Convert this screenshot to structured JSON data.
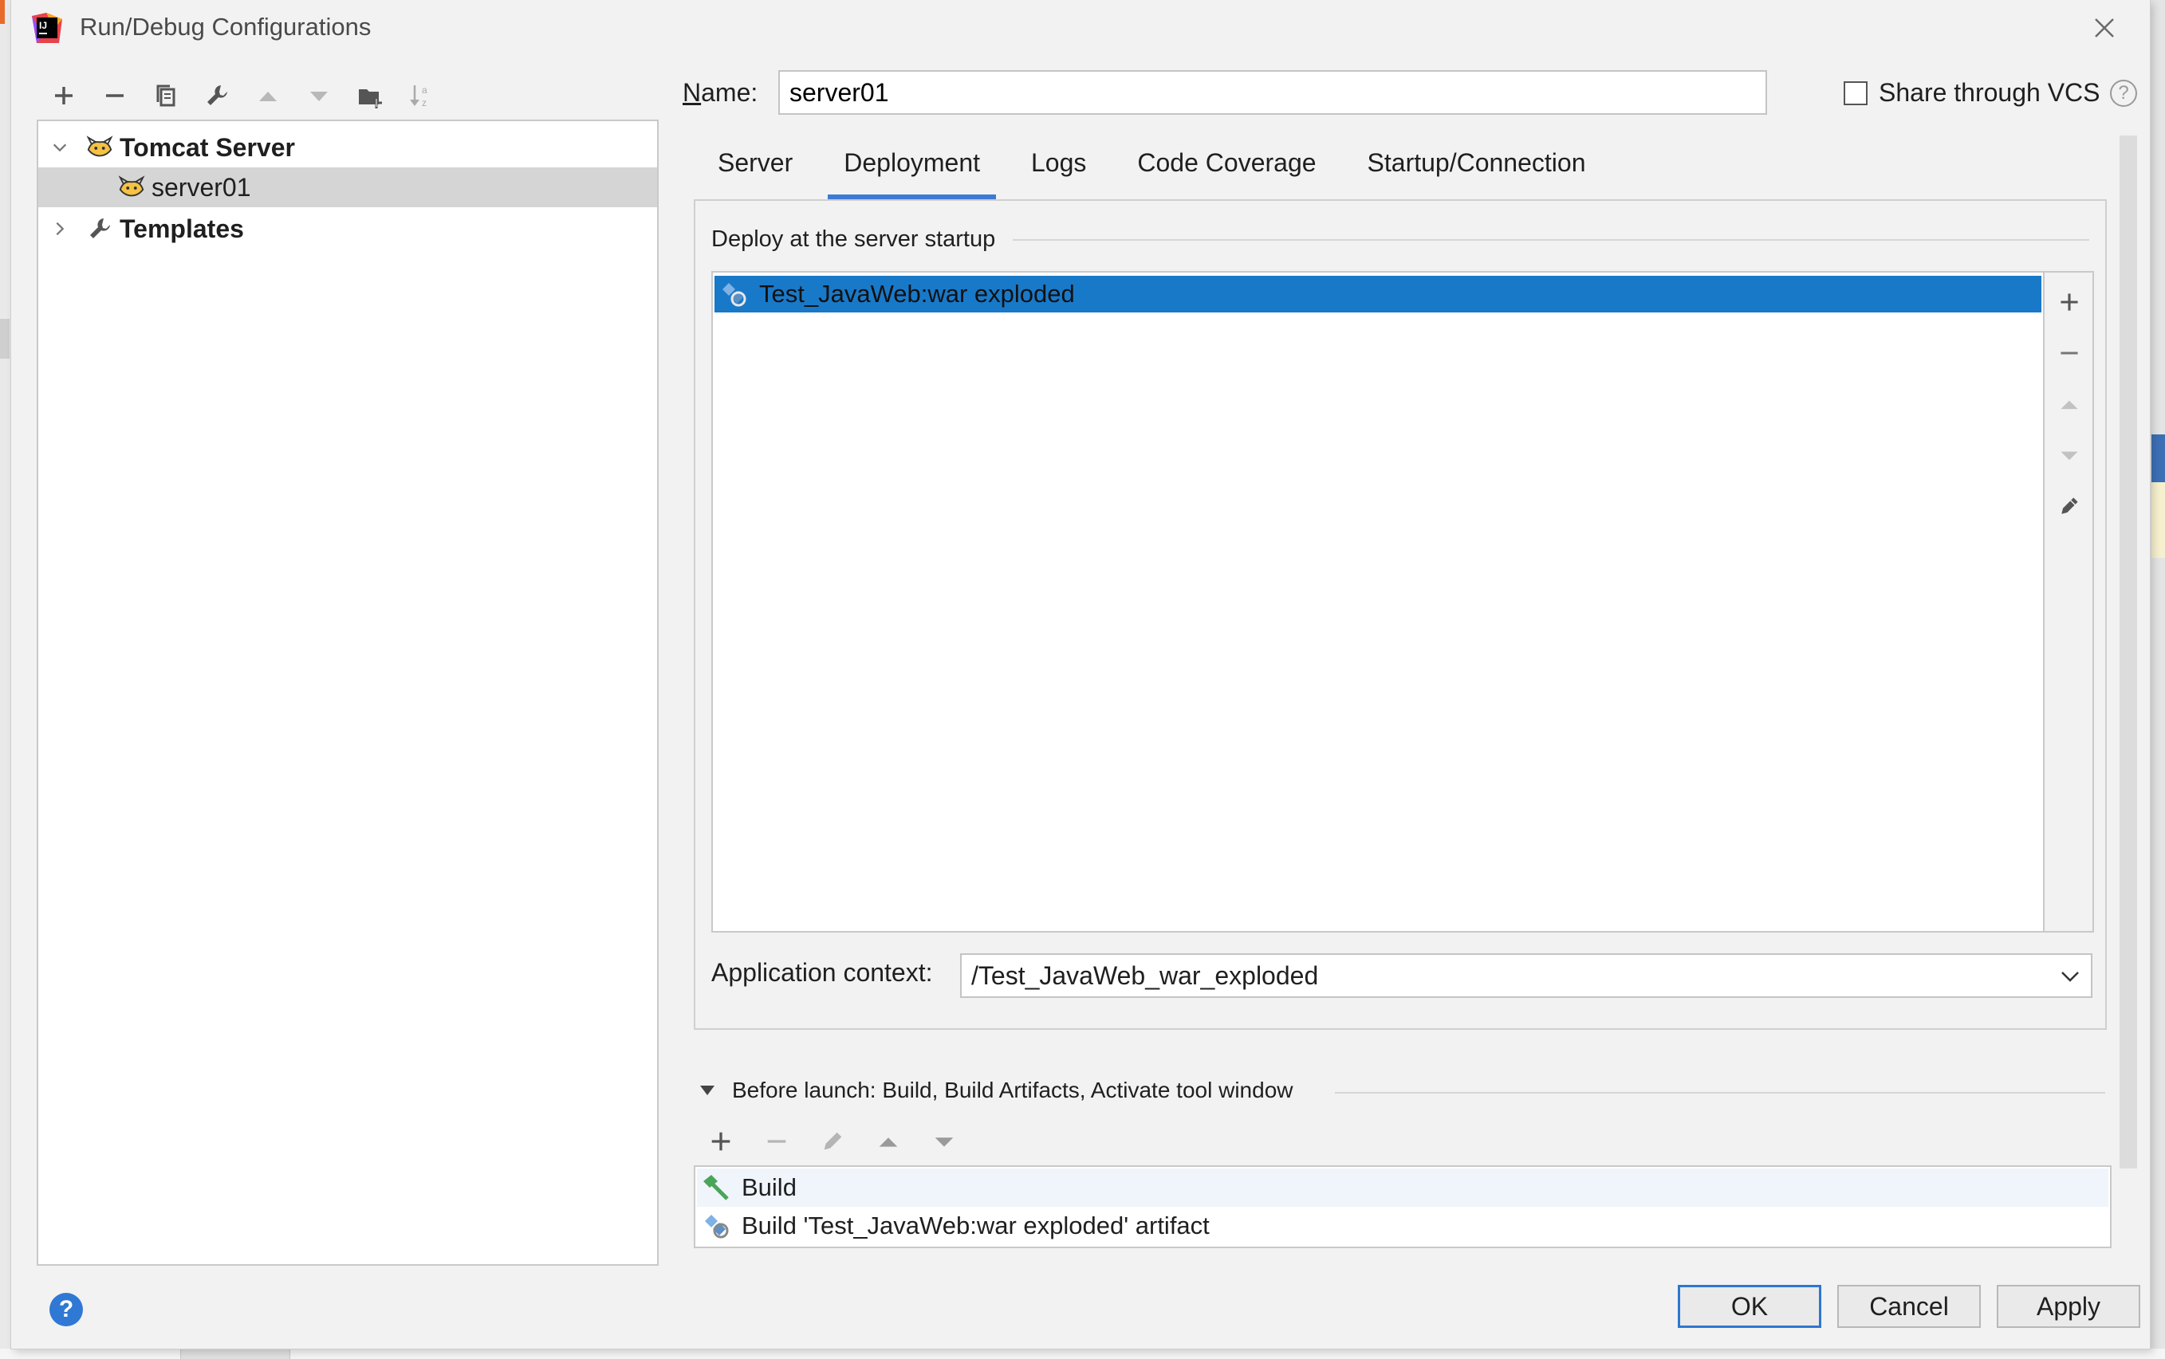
{
  "window": {
    "title": "Run/Debug Configurations"
  },
  "left_toolbar": {
    "icons": [
      "add-icon",
      "remove-icon",
      "copy-icon",
      "wrench-icon",
      "move-up-icon",
      "move-down-icon",
      "new-folder-icon",
      "sort-icon"
    ]
  },
  "tree": {
    "items": [
      {
        "label": "Tomcat Server",
        "expanded": true,
        "icon": "tomcat-icon"
      },
      {
        "label": "server01",
        "selected": true,
        "icon": "tomcat-icon"
      },
      {
        "label": "Templates",
        "expanded": false,
        "icon": "wrench-icon"
      }
    ]
  },
  "name_field": {
    "label": "Name:",
    "value": "server01"
  },
  "share_vcs": {
    "label": "Share through VCS",
    "checked": false
  },
  "tabs": [
    {
      "label": "Server",
      "active": false
    },
    {
      "label": "Deployment",
      "active": true
    },
    {
      "label": "Logs",
      "active": false
    },
    {
      "label": "Code Coverage",
      "active": false
    },
    {
      "label": "Startup/Connection",
      "active": false
    }
  ],
  "deployment": {
    "header": "Deploy at the server startup",
    "artifacts": [
      {
        "label": "Test_JavaWeb:war exploded",
        "selected": true
      }
    ],
    "side_toolbar": [
      "add-icon",
      "remove-icon",
      "move-up-icon",
      "move-down-icon",
      "edit-icon"
    ],
    "app_context": {
      "label": "Application context:",
      "value": "/Test_JavaWeb_war_exploded"
    }
  },
  "before_launch": {
    "header": "Before launch: Build, Build Artifacts, Activate tool window",
    "toolbar": [
      "add-icon",
      "remove-icon",
      "edit-icon",
      "move-up-icon",
      "move-down-icon"
    ],
    "items": [
      {
        "label": "Build",
        "icon": "hammer-icon"
      },
      {
        "label": "Build 'Test_JavaWeb:war exploded' artifact",
        "icon": "artifact-icon"
      }
    ]
  },
  "buttons": {
    "help": "?",
    "ok": "OK",
    "cancel": "Cancel",
    "apply": "Apply"
  },
  "colors": {
    "selection": "#1979c9",
    "tab_underline": "#3d7ad6",
    "dialog_bg": "#f2f2f2",
    "help_button": "#2f78d4"
  }
}
